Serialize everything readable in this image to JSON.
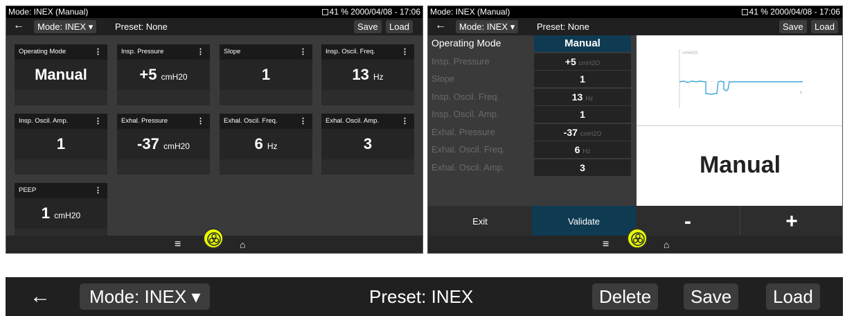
{
  "status": {
    "mode": "Mode: INEX (Manual)",
    "battery": "41 %",
    "datetime": "2000/04/08 - 17:06"
  },
  "toolbar": {
    "back": "←",
    "mode_btn": "Mode: INEX ▾",
    "preset": "Preset: None",
    "save": "Save",
    "load": "Load"
  },
  "tiles": [
    {
      "label": "Operating Mode",
      "value": "Manual",
      "unit": ""
    },
    {
      "label": "Insp. Pressure",
      "value": "+5",
      "unit": "cmH20"
    },
    {
      "label": "Slope",
      "value": "1",
      "unit": ""
    },
    {
      "label": "Insp. Oscil. Freq.",
      "value": "13",
      "unit": "Hz"
    },
    {
      "label": "Insp. Oscil. Amp.",
      "value": "1",
      "unit": ""
    },
    {
      "label": "Exhal. Pressure",
      "value": "-37",
      "unit": "cmH20"
    },
    {
      "label": "Exhal. Oscil. Freq.",
      "value": "6",
      "unit": "Hz"
    },
    {
      "label": "Exhal. Oscil. Amp.",
      "value": "3",
      "unit": ""
    },
    {
      "label": "PEEP",
      "value": "1",
      "unit": "cmH20"
    }
  ],
  "tile_menu_glyph": "⋮",
  "bottom": {
    "menu_icon": "≡",
    "home_icon": "⌂"
  },
  "params": [
    {
      "label": "Operating Mode",
      "value": "Manual",
      "unit": ""
    },
    {
      "label": "Insp. Pressure",
      "value": "+5",
      "unit": "cmH2O"
    },
    {
      "label": "Slope",
      "value": "1",
      "unit": ""
    },
    {
      "label": "Insp. Oscil. Freq.",
      "value": "13",
      "unit": "Hz"
    },
    {
      "label": "Insp. Oscil. Amp.",
      "value": "1",
      "unit": ""
    },
    {
      "label": "Exhal. Pressure",
      "value": "-37",
      "unit": "cmH2O"
    },
    {
      "label": "Exhal. Oscil. Freq.",
      "value": "6",
      "unit": "Hz"
    },
    {
      "label": "Exhal. Oscil. Amp.",
      "value": "3",
      "unit": ""
    }
  ],
  "selected_param": "Operating Mode",
  "preview": {
    "axis_label": "cmH2O",
    "axis_end": "s",
    "big_value": "Manual"
  },
  "buttons": {
    "exit": "Exit",
    "validate": "Validate",
    "minus": "-",
    "plus": "+"
  },
  "preset_bar": {
    "back": "←",
    "mode_btn": "Mode: INEX ▾",
    "preset": "Preset: INEX",
    "delete": "Delete",
    "save": "Save",
    "load": "Load"
  },
  "colors": {
    "selected": "#0f3b52",
    "accent": "#e8ff00",
    "waveform": "#3aa7d8"
  }
}
